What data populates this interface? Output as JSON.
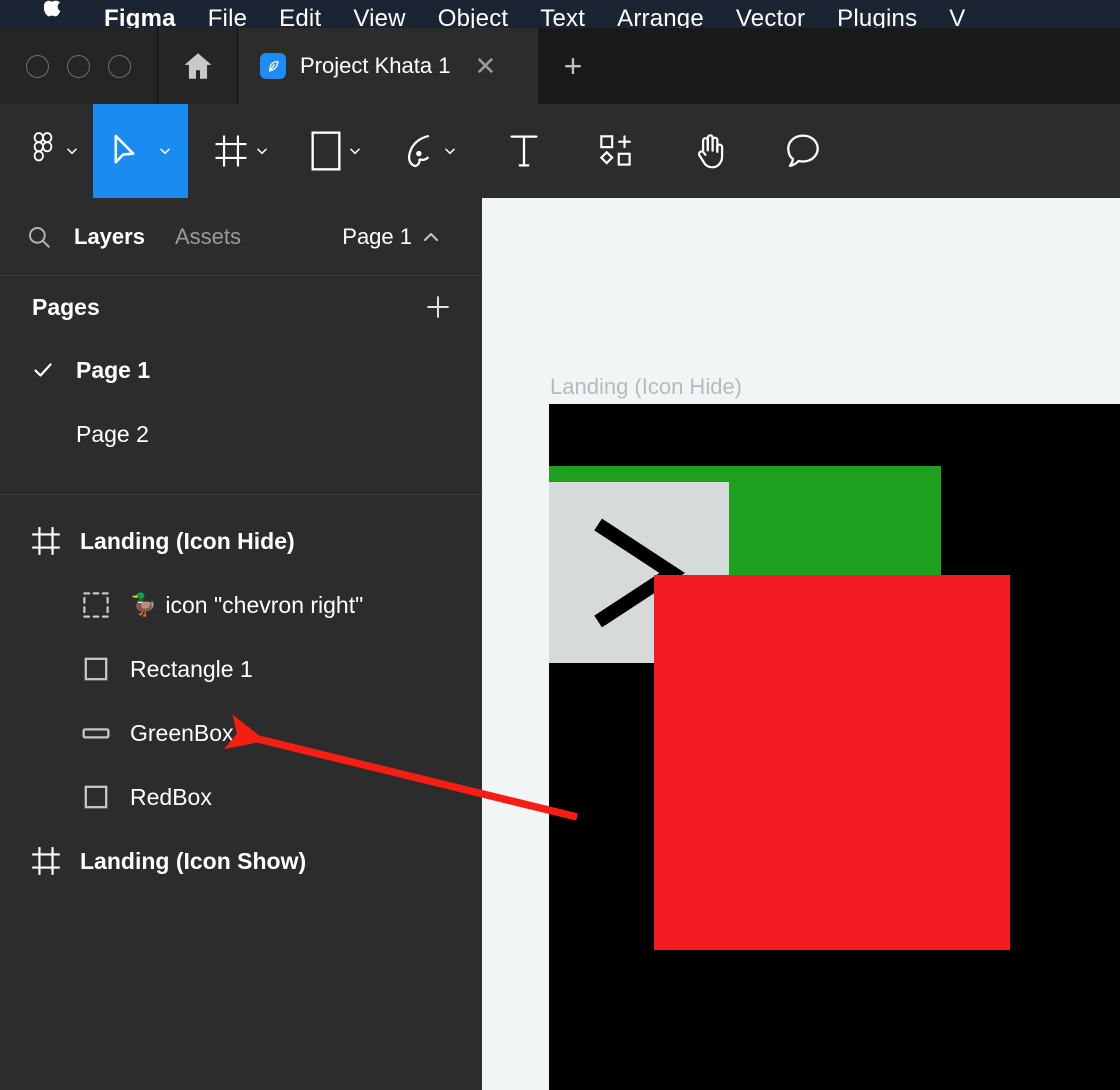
{
  "colors": {
    "accent_blue": "#1A8CF1",
    "tab_icon_blue": "#1F8CF5",
    "menubar_bg": "#1B2433",
    "panel_bg": "#2C2C2C",
    "canvas_bg": "#F2F5F6",
    "frame_black": "#000000",
    "green_box": "#1FA01F",
    "red_box": "#F31C25",
    "grey_box": "#D6DADB",
    "annotation_red": "#F41E12"
  },
  "menubar": {
    "apple_icon": "apple-logo-icon",
    "items": [
      {
        "label": "Figma",
        "bold": true
      },
      {
        "label": "File",
        "bold": false
      },
      {
        "label": "Edit",
        "bold": false
      },
      {
        "label": "View",
        "bold": false
      },
      {
        "label": "Object",
        "bold": false
      },
      {
        "label": "Text",
        "bold": false
      },
      {
        "label": "Arrange",
        "bold": false
      },
      {
        "label": "Vector",
        "bold": false
      },
      {
        "label": "Plugins",
        "bold": false
      },
      {
        "label": "V",
        "bold": false
      }
    ]
  },
  "tabbar": {
    "window_controls": [
      "close",
      "minimize",
      "maximize"
    ],
    "home_icon": "home-icon",
    "tab": {
      "icon": "figma-pen-icon",
      "title": "Project Khata 1",
      "close_label": "✕"
    },
    "new_tab_label": "+"
  },
  "toolbar": {
    "tools": [
      {
        "name": "figma-menu",
        "icon": "figma-logo-icon",
        "caret": true,
        "active": false
      },
      {
        "name": "move",
        "icon": "cursor-icon",
        "caret": true,
        "active": true
      },
      {
        "name": "frame",
        "icon": "frame-icon",
        "caret": true,
        "active": false
      },
      {
        "name": "shape",
        "icon": "rectangle-icon",
        "caret": true,
        "active": false
      },
      {
        "name": "pen",
        "icon": "pen-icon",
        "caret": true,
        "active": false
      },
      {
        "name": "text",
        "icon": "text-icon",
        "caret": false,
        "active": false
      },
      {
        "name": "resources",
        "icon": "components-icon",
        "caret": false,
        "active": false
      },
      {
        "name": "hand",
        "icon": "hand-icon",
        "caret": false,
        "active": false
      },
      {
        "name": "comment",
        "icon": "comment-icon",
        "caret": false,
        "active": false
      }
    ]
  },
  "sidebar": {
    "search_icon": "search-icon",
    "tabs": [
      {
        "label": "Layers",
        "selected": true
      },
      {
        "label": "Assets",
        "selected": false
      }
    ],
    "page_selector": {
      "label": "Page 1",
      "caret": "chevron-up-icon"
    },
    "pages": {
      "title": "Pages",
      "add_label": "+",
      "items": [
        {
          "label": "Page 1",
          "current": true
        },
        {
          "label": "Page 2",
          "current": false
        }
      ]
    },
    "layers": [
      {
        "label": "Landing (Icon Hide)",
        "icon": "frame-icon",
        "indent": false,
        "bold": true,
        "emoji": ""
      },
      {
        "label": "icon \"chevron right\"",
        "icon": "component-instance-icon",
        "indent": true,
        "bold": false,
        "emoji": "🦆"
      },
      {
        "label": "Rectangle 1",
        "icon": "rectangle-icon",
        "indent": true,
        "bold": false,
        "emoji": ""
      },
      {
        "label": "GreenBox",
        "icon": "wide-rect-icon",
        "indent": true,
        "bold": false,
        "emoji": ""
      },
      {
        "label": "RedBox",
        "icon": "rectangle-icon",
        "indent": true,
        "bold": false,
        "emoji": ""
      },
      {
        "label": "Landing (Icon Show)",
        "icon": "frame-icon",
        "indent": false,
        "bold": true,
        "emoji": ""
      }
    ]
  },
  "canvas": {
    "frame_label": "Landing (Icon Hide)",
    "shapes": [
      {
        "name": "frame-background",
        "color": "#000000"
      },
      {
        "name": "GreenBox",
        "color": "#1FA01F"
      },
      {
        "name": "Rectangle 1",
        "color": "#D6DADB"
      },
      {
        "name": "RedBox",
        "color": "#F31C25"
      },
      {
        "name": "chevron-right-icon",
        "color": "#000000"
      }
    ]
  },
  "annotation": {
    "type": "arrow",
    "points_to": "GreenBox",
    "color": "#F41E12"
  }
}
